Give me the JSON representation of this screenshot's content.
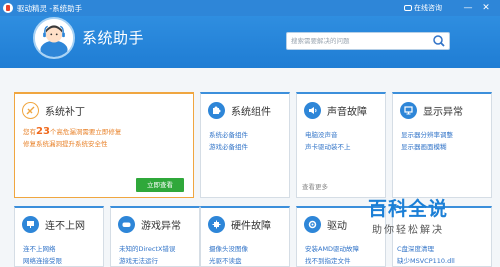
{
  "window": {
    "title": "驱动精灵 -系统助手",
    "online_help": "在线咨询",
    "minimize": "—",
    "close": "✕"
  },
  "header": {
    "title": "系统助手",
    "search_placeholder": "搜索需要解决的问题"
  },
  "cards": {
    "patch": {
      "title": "系统补丁",
      "line1_prefix": "您有",
      "line1_count": "23",
      "line1_suffix": "个高危漏洞需要立即修复",
      "line2": "修复系统漏洞提升系统安全性",
      "button": "立即查看"
    },
    "components": {
      "title": "系统组件",
      "links": [
        "系统必备组件",
        "游戏必备组件"
      ]
    },
    "sound": {
      "title": "声音故障",
      "links": [
        "电脑没声音",
        "声卡驱动装不上"
      ],
      "more": "查看更多"
    },
    "display": {
      "title": "显示异常",
      "links": [
        "显示器分辨率调整",
        "显示器画面模糊"
      ]
    },
    "network": {
      "title": "连不上网",
      "links": [
        "连不上网络",
        "网络连接受限"
      ]
    },
    "game": {
      "title": "游戏异常",
      "links": [
        "未知的DirectX错误",
        "游戏无法运行"
      ]
    },
    "hardware": {
      "title": "硬件故障",
      "links": [
        "摄像头没图像",
        "光驱不读盘"
      ]
    },
    "driver": {
      "title": "驱动",
      "links": [
        "安装AMD驱动故障",
        "找不到指定文件"
      ]
    },
    "misc": {
      "links": [
        "C盘深度清理",
        "缺少MSVCP110.dll"
      ]
    }
  },
  "watermark": {
    "title": "百科全说",
    "subtitle": "助你轻松解决"
  },
  "colors": {
    "accent": "#2e86d8",
    "highlight": "#f0a640",
    "button": "#2fa83a"
  }
}
